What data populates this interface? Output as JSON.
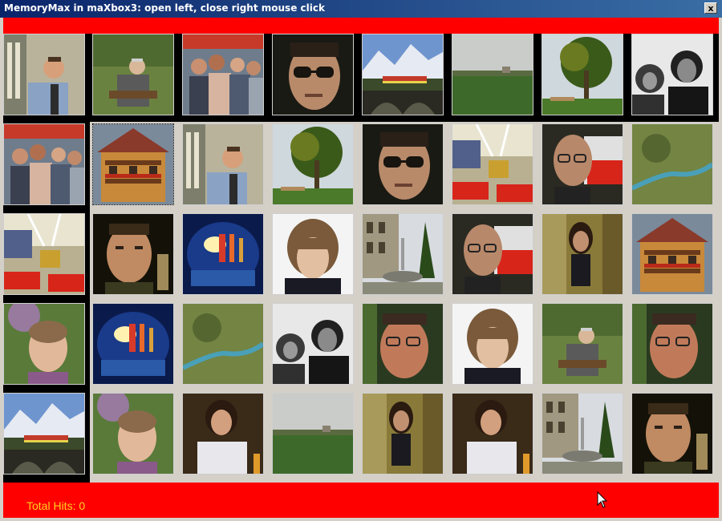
{
  "window": {
    "title": "MemoryMax in maXbox3: open left, close right mouse click",
    "close_label": "x"
  },
  "status": {
    "total_hits_text": "Total Hits: 0"
  },
  "colors": {
    "title_bar": "#0a246a",
    "panel_red": "#ff0000",
    "hits_text": "#ffd21f",
    "board_bg": "#000000"
  },
  "board": {
    "rows": 5,
    "columns": 8,
    "cards": [
      [
        "station-man",
        "old-man-chair",
        "crowd",
        "sunglasses-man",
        "mountain-train",
        "meadow",
        "tree-bench",
        "bw-group"
      ],
      [
        "crowd",
        "chalet",
        "station-man",
        "tree-bench",
        "sunglasses-man",
        "hallway-red-seats",
        "glasses-man-booth",
        "aerial-river"
      ],
      [
        "hallway-red-seats",
        "man-portrait",
        "tunnel-lights",
        "boy-portrait",
        "fountain-building",
        "glasses-man-booth",
        "woman-curtain",
        "chalet"
      ],
      [
        "girl-garden",
        "tunnel-lights",
        "aerial-river",
        "bw-group",
        "glasses-man-indoor",
        "boy-portrait",
        "old-man-chair",
        "glasses-man-indoor"
      ],
      [
        "mountain-train",
        "girl-garden",
        "woman-sweater",
        "meadow",
        "woman-curtain",
        "woman-sweater",
        "fountain-building",
        "man-portrait"
      ]
    ]
  }
}
